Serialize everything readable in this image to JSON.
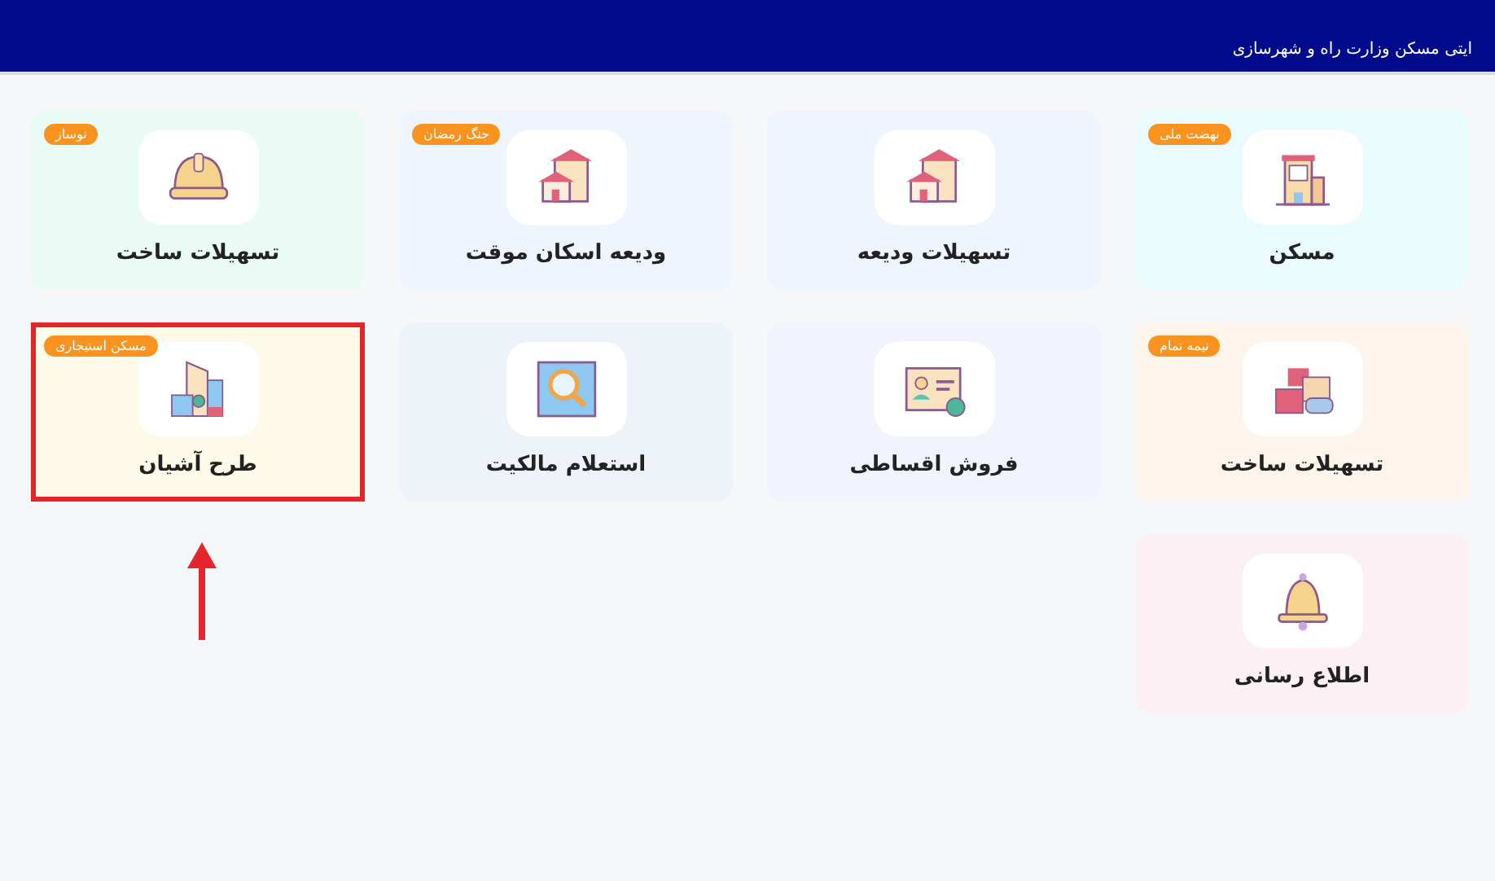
{
  "header": {
    "subtitle": "ایتی مسکن وزارت راه و شهرسازی"
  },
  "cards": [
    {
      "label": "مسکن",
      "badge": "نهضت ملی",
      "color": "#e9fbfd",
      "highlighted": false
    },
    {
      "label": "تسهیلات ودیعه",
      "color": "#eef5fd",
      "highlighted": false
    },
    {
      "label": "ودیعه اسکان موقت",
      "badge": "جنگ رمضان",
      "color": "#eef5fd",
      "highlighted": false
    },
    {
      "label": "تسهیلات ساخت",
      "badge": "نوساز",
      "color": "#e9fbf4",
      "highlighted": false
    },
    {
      "label": "تسهیلات ساخت",
      "badge": "نیمه تمام",
      "color": "#fdf5ec",
      "highlighted": false
    },
    {
      "label": "فروش اقساطی",
      "color": "#f1f3fd",
      "highlighted": false
    },
    {
      "label": "استعلام مالکیت",
      "color": "#eef3f9",
      "highlighted": false
    },
    {
      "label": "طرح آشیان",
      "badge": "مسکن استیجاری",
      "color": "#fdfaea",
      "highlighted": true
    },
    {
      "label": "اطلاع رسانی",
      "color": "#fdf0f4",
      "highlighted": false
    }
  ]
}
